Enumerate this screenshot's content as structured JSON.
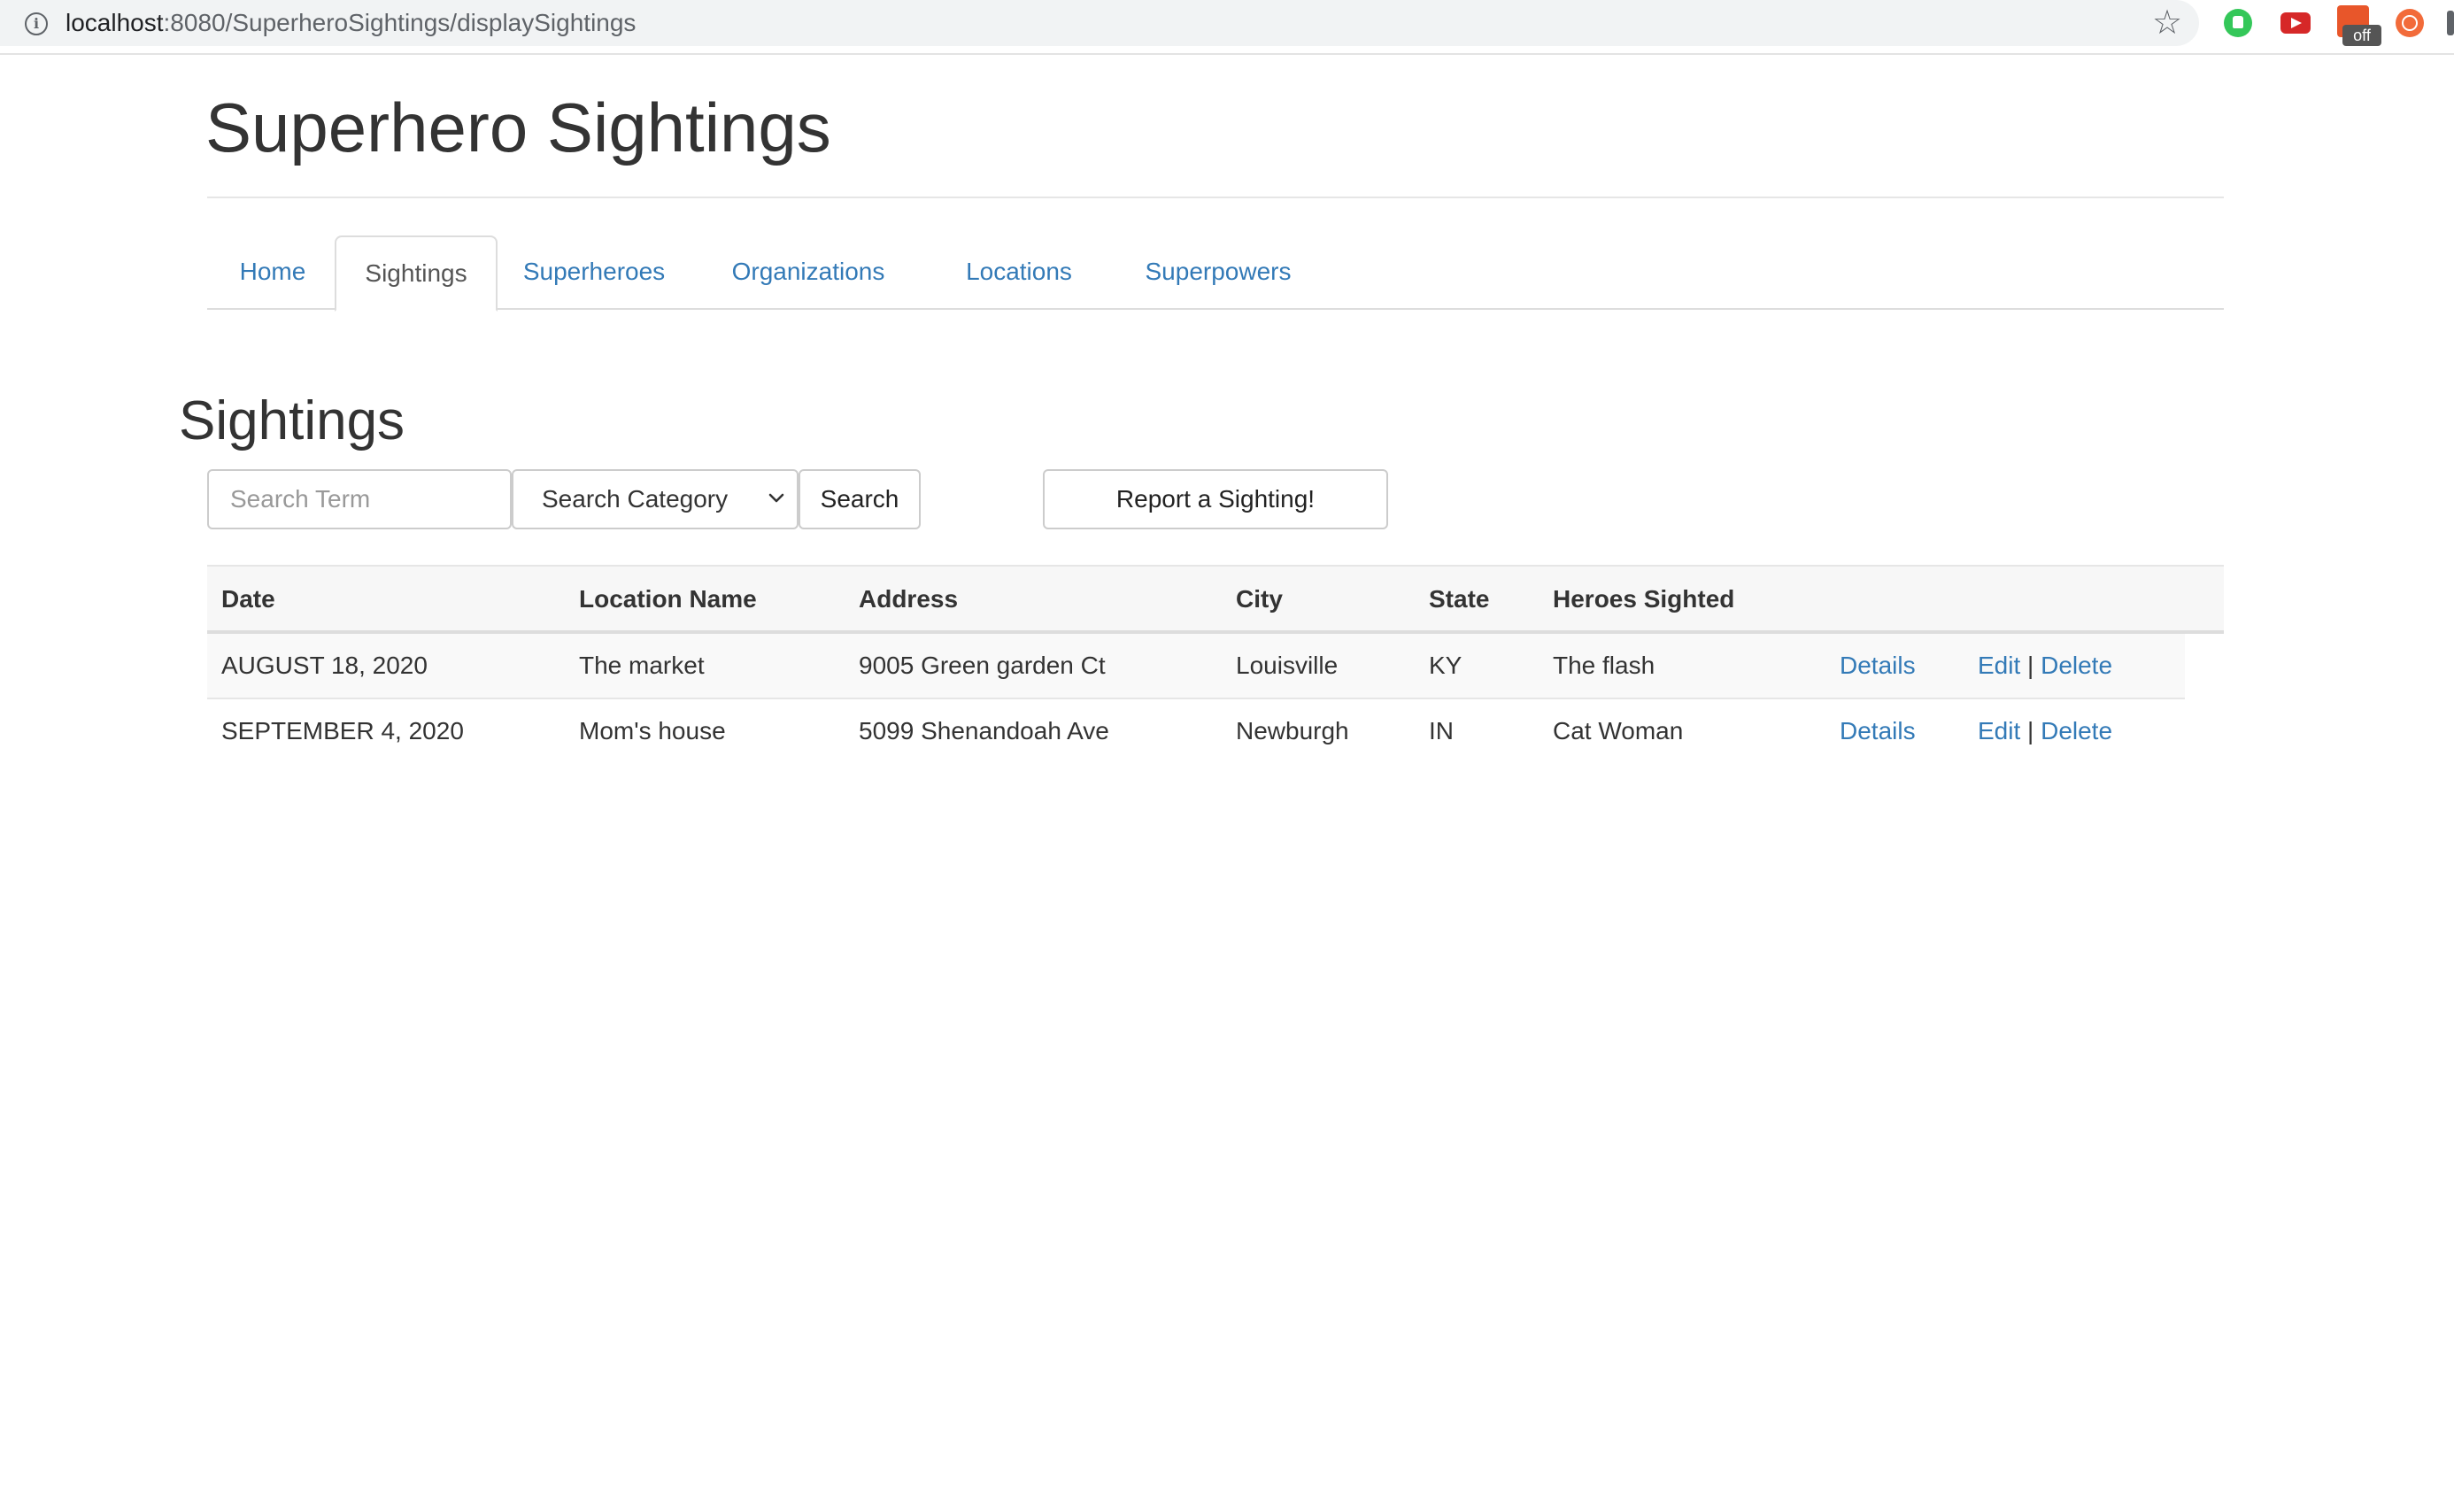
{
  "browser": {
    "url_host": "localhost",
    "url_path": ":8080/SuperheroSightings/displaySightings",
    "extension_badge": "off"
  },
  "header": {
    "title": "Superhero Sightings"
  },
  "nav": {
    "tabs": [
      {
        "label": "Home",
        "active": false
      },
      {
        "label": "Sightings",
        "active": true
      },
      {
        "label": "Superheroes",
        "active": false
      },
      {
        "label": "Organizations",
        "active": false
      },
      {
        "label": "Locations",
        "active": false
      },
      {
        "label": "Superpowers",
        "active": false
      }
    ]
  },
  "main": {
    "title": "Sightings",
    "search": {
      "placeholder": "Search Term",
      "value": "",
      "category_selected": "Search Category",
      "button_label": "Search"
    },
    "report_button_label": "Report a Sighting!",
    "table": {
      "columns": [
        "Date",
        "Location Name",
        "Address",
        "City",
        "State",
        "Heroes Sighted"
      ],
      "rows": [
        {
          "date": "AUGUST 18, 2020",
          "location_name": "The market",
          "address": "9005 Green garden Ct",
          "city": "Louisville",
          "state": "KY",
          "heroes": "The flash",
          "details_label": "Details",
          "edit_label": "Edit",
          "separator": "|",
          "delete_label": "Delete"
        },
        {
          "date": "SEPTEMBER 4, 2020",
          "location_name": "Mom's house",
          "address": "5099 Shenandoah Ave",
          "city": "Newburgh",
          "state": "IN",
          "heroes": "Cat Woman",
          "details_label": "Details",
          "edit_label": "Edit",
          "separator": "|",
          "delete_label": "Delete"
        }
      ]
    }
  },
  "colors": {
    "link": "#337ab7",
    "text": "#333333",
    "border": "#dddddd"
  }
}
